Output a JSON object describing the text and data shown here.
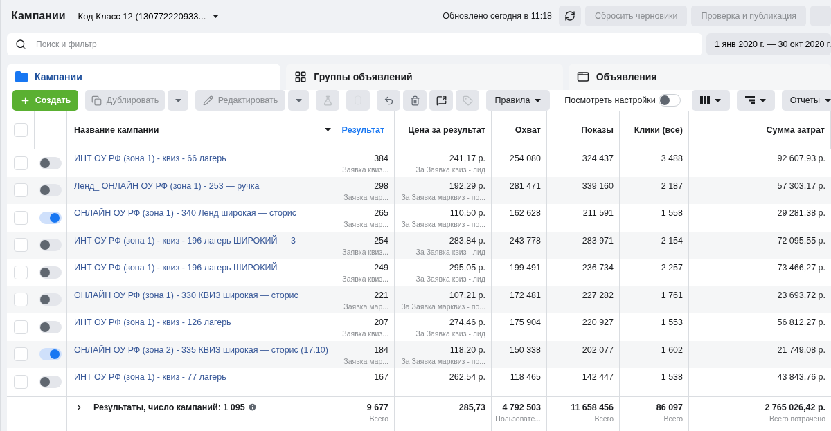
{
  "header": {
    "title": "Кампании",
    "account": "Код Класс 12 (130772220933...",
    "updated": "Обновлено сегодня в 11:18",
    "buttons": [
      {
        "label": "Сбросить черновики",
        "disabled": true
      },
      {
        "label": "Проверка и публикация",
        "disabled": true
      }
    ]
  },
  "search": {
    "placeholder": "Поиск и фильтр"
  },
  "date_range": "1 янв 2020 г. — 30 окт 2020 г.",
  "tabs": [
    {
      "label": "Кампании",
      "selected": true
    },
    {
      "label": "Группы объявлений",
      "selected": false
    },
    {
      "label": "Объявления",
      "selected": false
    }
  ],
  "toolbar": {
    "create": "Создать",
    "duplicate": "Дублировать",
    "edit": "Редактировать",
    "rules": "Правила",
    "view_settings": {
      "label": "Посмотреть настройки",
      "on": false
    },
    "reports": "Отчеты"
  },
  "table": {
    "all_checked": false,
    "columns": [
      {
        "label": "Название кампании",
        "sorted": false
      },
      {
        "label": "Результат",
        "sorted": true
      },
      {
        "label": "Цена за результат",
        "sorted": false
      },
      {
        "label": "Охват",
        "sorted": false
      },
      {
        "label": "Показы",
        "sorted": false
      },
      {
        "label": "Клики (все)",
        "sorted": false
      },
      {
        "label": "Сумма затрат",
        "sorted": false
      }
    ],
    "rows": [
      {
        "checked": false,
        "on": false,
        "name": "ИНТ ОУ РФ (зона 1) - квиз - 66 лагерь",
        "result": "384",
        "result_sub": "Заявка квиз...",
        "cost": "241,17 р.",
        "cost_sub": "За Заявка квиз - лид",
        "reach": "254 080",
        "impressions": "324 437",
        "clicks": "3 488",
        "spend": "92 607,93 р."
      },
      {
        "checked": false,
        "on": false,
        "name": "Ленд_ ОНЛАЙН ОУ РФ (зона 1) - 253 — ручка",
        "result": "298",
        "result_sub": "Заявка мар...",
        "cost": "192,29 р.",
        "cost_sub": "За Заявка марквиз - по...",
        "reach": "281 471",
        "impressions": "339 160",
        "clicks": "2 187",
        "spend": "57 303,17 р."
      },
      {
        "checked": false,
        "on": true,
        "name": "ОНЛАЙН ОУ РФ (зона 1) - 340 Ленд широкая — сторис",
        "result": "265",
        "result_sub": "Заявка мар...",
        "cost": "110,50 р.",
        "cost_sub": "За Заявка марквиз - по...",
        "reach": "162 628",
        "impressions": "211 591",
        "clicks": "1 558",
        "spend": "29 281,38 р."
      },
      {
        "checked": false,
        "on": false,
        "name": "ИНТ ОУ РФ (зона 1) - квиз - 196 лагерь ШИРОКИЙ — 3",
        "result": "254",
        "result_sub": "Заявка квиз...",
        "cost": "283,84 р.",
        "cost_sub": "За Заявка квиз - лид",
        "reach": "243 778",
        "impressions": "283 971",
        "clicks": "2 154",
        "spend": "72 095,55 р."
      },
      {
        "checked": false,
        "on": false,
        "name": "ИНТ ОУ РФ (зона 1) - квиз - 196 лагерь ШИРОКИЙ",
        "result": "249",
        "result_sub": "Заявка квиз...",
        "cost": "295,05 р.",
        "cost_sub": "За Заявка квиз - лид",
        "reach": "199 491",
        "impressions": "236 734",
        "clicks": "2 257",
        "spend": "73 466,27 р."
      },
      {
        "checked": false,
        "on": false,
        "name": "ОНЛАЙН ОУ РФ (зона 1) - 330 КВИЗ широкая — сторис",
        "result": "221",
        "result_sub": "Заявка мар...",
        "cost": "107,21 р.",
        "cost_sub": "За Заявка марквиз - по...",
        "reach": "172 481",
        "impressions": "227 282",
        "clicks": "1 761",
        "spend": "23 693,72 р."
      },
      {
        "checked": false,
        "on": false,
        "name": "ИНТ ОУ РФ (зона 1) - квиз - 126 лагерь",
        "result": "207",
        "result_sub": "Заявка квиз...",
        "cost": "274,46 р.",
        "cost_sub": "За Заявка квиз - лид",
        "reach": "175 904",
        "impressions": "220 927",
        "clicks": "1 553",
        "spend": "56 812,27 р."
      },
      {
        "checked": false,
        "on": true,
        "name": "ОНЛАЙН ОУ РФ (зона 2) - 335 КВИЗ широкая — сторис (17.10)",
        "result": "184",
        "result_sub": "Заявка мар...",
        "cost": "118,20 р.",
        "cost_sub": "За Заявка марквиз - по...",
        "reach": "150 338",
        "impressions": "202 077",
        "clicks": "1 602",
        "spend": "21 749,08 р."
      },
      {
        "checked": false,
        "on": false,
        "name": "ИНТ ОУ РФ (зона 1) - квиз - 77 лагерь",
        "result": "167",
        "cost": "262,54 р.",
        "reach": "118 465",
        "impressions": "142 447",
        "clicks": "1 538",
        "spend": "43 843,76 р."
      }
    ],
    "footer": {
      "label": "Результаты, число кампаний: 1 095",
      "result": "9 677",
      "result_sub": "Всего",
      "cost": "285,73",
      "reach": "4 792 503",
      "reach_sub": "Пользовате...",
      "impressions": "11 658 456",
      "impressions_sub": "Всего",
      "clicks": "86 097",
      "clicks_sub": "Всего",
      "spend": "2 765 026,42 р.",
      "spend_sub": "Всего потрачено"
    }
  }
}
